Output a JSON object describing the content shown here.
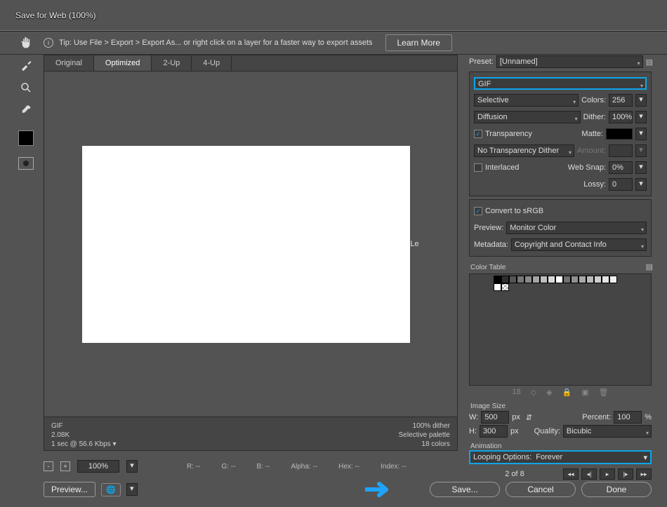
{
  "window": {
    "title": "Save for Web (100%)"
  },
  "tip": {
    "text": "Tip: Use File > Export > Export As...   or right click on a layer for a faster way to export assets",
    "learn": "Learn More"
  },
  "tabs": [
    "Original",
    "Optimized",
    "2-Up",
    "4-Up"
  ],
  "canvas_text": "Le",
  "info": {
    "format": "GIF",
    "size": "2.08K",
    "time": "1 sec @ 56.6 Kbps",
    "dither": "100% dither",
    "palette": "Selective palette",
    "colors": "18 colors"
  },
  "zoom": {
    "value": "100%",
    "r": "R: --",
    "g": "G: --",
    "b": "B: --",
    "alpha": "Alpha: --",
    "hex": "Hex: --",
    "index": "Index: --"
  },
  "preset": {
    "label": "Preset:",
    "value": "[Unnamed]"
  },
  "fmt": {
    "format": "GIF",
    "reduction": "Selective",
    "colors_lbl": "Colors:",
    "colors": "256",
    "dither_alg": "Diffusion",
    "dither_lbl": "Dither:",
    "dither": "100%",
    "transparency": "Transparency",
    "matte_lbl": "Matte:",
    "trans_dither": "No Transparency Dither",
    "amount_lbl": "Amount:",
    "interlaced": "Interlaced",
    "websnap_lbl": "Web Snap:",
    "websnap": "0%",
    "lossy_lbl": "Lossy:",
    "lossy": "0"
  },
  "conv": {
    "srgb": "Convert to sRGB",
    "preview_lbl": "Preview:",
    "preview": "Monitor Color",
    "meta_lbl": "Metadata:",
    "meta": "Copyright and Contact Info"
  },
  "ctable": {
    "label": "Color Table",
    "count": "18",
    "colors": [
      "#000000",
      "#2d2d2d",
      "#555555",
      "#777777",
      "#8a8a8a",
      "#a5a5a5",
      "#bfbfbf",
      "#d9d9d9",
      "#ffffff",
      "#6f6f6f",
      "#909090",
      "#a9a9a9",
      "#bcbcbc",
      "#cfcfcf",
      "#e5e5e5",
      "#f0f0f0"
    ]
  },
  "imgsize": {
    "label": "Image Size",
    "w_lbl": "W:",
    "w": "500",
    "h_lbl": "H:",
    "h": "300",
    "px": "px",
    "pct_lbl": "Percent:",
    "pct": "100",
    "pct_u": "%",
    "q_lbl": "Quality:",
    "q": "Bicubic"
  },
  "anim": {
    "label": "Animation",
    "loop_lbl": "Looping Options:",
    "loop": "Forever",
    "frame": "2 of 8"
  },
  "buttons": {
    "preview": "Preview...",
    "save": "Save...",
    "cancel": "Cancel",
    "done": "Done"
  }
}
